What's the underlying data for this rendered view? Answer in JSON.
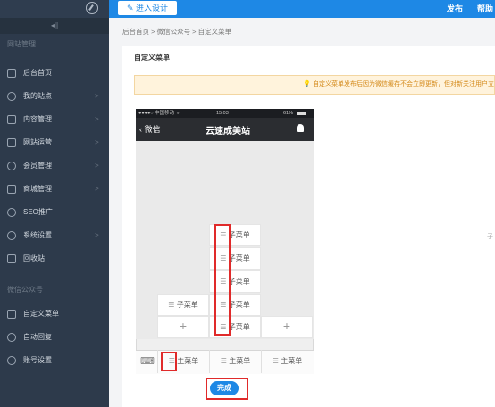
{
  "topbar": {
    "design_label": "进入设计",
    "publish_label": "发布",
    "help_label": "帮助"
  },
  "sidebar": {
    "collapse_glyph": "◂||",
    "group_site": "网站管理",
    "items_site": [
      {
        "label": "后台首页",
        "icon": "home-icon"
      },
      {
        "label": "我的站点",
        "icon": "globe-icon"
      },
      {
        "label": "内容管理",
        "icon": "document-icon"
      },
      {
        "label": "网站运营",
        "icon": "monitor-icon"
      },
      {
        "label": "会员管理",
        "icon": "users-icon"
      },
      {
        "label": "商城管理",
        "icon": "store-icon"
      },
      {
        "label": "SEO推广",
        "icon": "search-icon"
      },
      {
        "label": "系统设置",
        "icon": "gear-icon"
      },
      {
        "label": "回收站",
        "icon": "trash-icon"
      }
    ],
    "group_wechat": "微信公众号",
    "items_wechat": [
      {
        "label": "自定义菜单",
        "icon": "grid-icon"
      },
      {
        "label": "自动回复",
        "icon": "chat-icon"
      },
      {
        "label": "账号设置",
        "icon": "account-icon"
      }
    ],
    "arrow": ">"
  },
  "breadcrumb": {
    "home": "后台首页",
    "wechat": "微信公众号",
    "current": "自定义菜单",
    "sep": ">"
  },
  "panel": {
    "title": "自定义菜单",
    "notice": "自定义菜单发布后因为微信缓存不会立即更新，但对新关注用户立",
    "side_text": "子"
  },
  "phone": {
    "status_left": "●●●●○ 中国移动 ᯤ",
    "status_time": "15:03",
    "status_right": "61%",
    "back_label": "微信",
    "site_title": "云速成美站",
    "sub_label": "子菜单",
    "main_label": "主菜单",
    "hamburger": "☰",
    "plus": "+",
    "keyboard": "⌨"
  },
  "done_label": "完成",
  "colors": {
    "accent": "#1e88e5",
    "sidebar": "#2d3a4b",
    "highlight": "#e02a2a"
  }
}
